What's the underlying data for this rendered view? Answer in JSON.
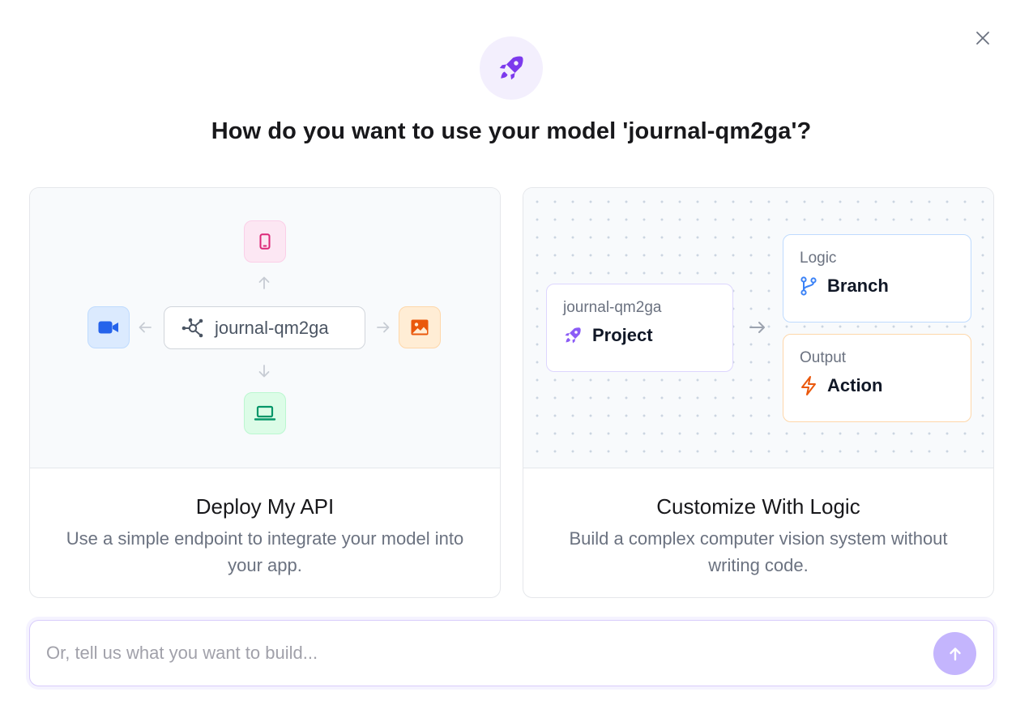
{
  "dialog": {
    "title": "How do you want to use your model 'journal-qm2ga'?",
    "close_icon": "close-icon",
    "hero_icon": "rocket-icon"
  },
  "cards": {
    "deploy": {
      "title": "Deploy My API",
      "description": "Use a simple endpoint to integrate your model into your app.",
      "model_name": "journal-qm2ga",
      "icons": [
        "smartphone-icon",
        "video-camera-icon",
        "image-icon",
        "laptop-icon",
        "model-graph-icon"
      ]
    },
    "logic": {
      "title": "Customize With Logic",
      "description": "Build a complex computer vision system without writing code.",
      "project_box": {
        "subtitle": "journal-qm2ga",
        "label": "Project",
        "icon": "rocket-icon"
      },
      "logic_box": {
        "subtitle": "Logic",
        "label": "Branch",
        "icon": "git-branch-icon"
      },
      "output_box": {
        "subtitle": "Output",
        "label": "Action",
        "icon": "lightning-icon"
      }
    }
  },
  "prompt": {
    "placeholder": "Or, tell us what you want to build...",
    "value": "",
    "send_icon": "arrow-up-icon"
  },
  "colors": {
    "accent_purple": "#7c3aed",
    "send_button": "#c4b5fd",
    "pink": "#db2777",
    "blue": "#2563eb",
    "orange": "#ea580c",
    "green": "#059669"
  }
}
